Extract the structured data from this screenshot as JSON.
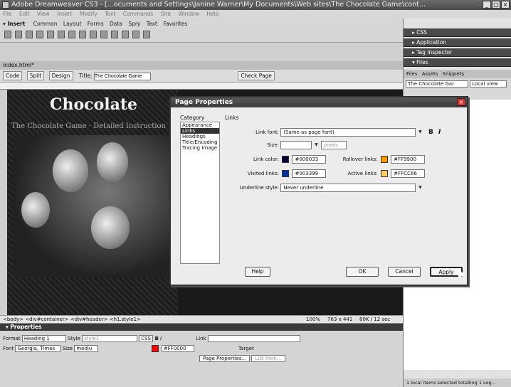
{
  "window": {
    "title": "Adobe Dreamweaver CS3 - [...ocuments and Settings\\Janine Warner\\My Documents\\Web sites\\The Chocolate Game\\cont..."
  },
  "menubar": [
    "File",
    "Edit",
    "View",
    "Insert",
    "Modify",
    "Text",
    "Commands",
    "Site",
    "Window",
    "Help"
  ],
  "insert": {
    "label": "▾ Insert",
    "tabs": [
      "Common",
      "Layout",
      "Forms",
      "Data",
      "Spry",
      "Text",
      "Favorites"
    ]
  },
  "doc": {
    "tab": "index.html*",
    "code_btn": "Code",
    "split_btn": "Split",
    "design_btn": "Design",
    "title_label": "Title:",
    "title_value": "The Chocolate Game",
    "check_page": "Check Page"
  },
  "site": {
    "heading": "Chocolate",
    "subheading": "The Chocolate Game · Detailed Instruction"
  },
  "statusbar": {
    "tags": "<body> <div#container> <div#header> <h1.style1>",
    "zoom": "100%",
    "size": "763 x 441",
    "weight": "80K / 12 sec"
  },
  "properties": {
    "header": "▾ Properties",
    "format_label": "Format",
    "format_value": "Heading 1",
    "style_label": "Style",
    "style_value": "style1",
    "css_btn": "CSS",
    "link_label": "Link",
    "font_label": "Font",
    "font_value": "Georgia, Times",
    "size_label": "Size",
    "size_value": "mediu",
    "color_value": "#FF0000",
    "target_label": "Target",
    "page_props_btn": "Page Properties...",
    "list_item_btn": "List Item..."
  },
  "right": {
    "groups": [
      "▸ CSS",
      "▸ Application",
      "▸ Tag Inspector",
      "▾ Files"
    ],
    "tabs": [
      "Files",
      "Assets",
      "Snippets"
    ],
    "site_select": "The Chocolate Gar",
    "view_select": "Local view",
    "status": "1 local items selected totalling 1 Log..."
  },
  "dialog": {
    "title": "Page Properties",
    "category_label": "Category",
    "categories": [
      "Appearance",
      "Links",
      "Headings",
      "Title/Encoding",
      "Tracing Image"
    ],
    "active_category": 1,
    "section_label": "Links",
    "link_font_label": "Link font:",
    "link_font_value": "(Same as page font)",
    "size_label": "Size:",
    "size_unit": "pixels",
    "link_color_label": "Link color:",
    "link_color_value": "#000033",
    "rollover_label": "Rollover links:",
    "rollover_value": "#FF9900",
    "visited_label": "Visited links:",
    "visited_value": "#003399",
    "active_label": "Active links:",
    "active_value": "#FFCC66",
    "underline_label": "Underline style:",
    "underline_value": "Never underline",
    "help_btn": "Help",
    "ok_btn": "OK",
    "cancel_btn": "Cancel",
    "apply_btn": "Apply"
  },
  "colors": {
    "link": "#000033",
    "rollover": "#FF9900",
    "visited": "#003399",
    "active": "#FFCC66",
    "font_color": "#FF0000"
  }
}
